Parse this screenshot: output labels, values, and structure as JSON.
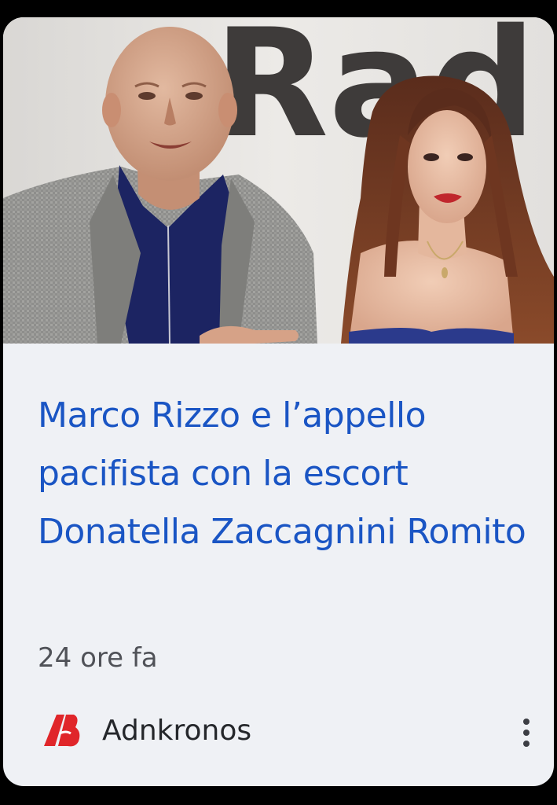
{
  "article": {
    "thumbnail": {
      "description_icon": "news-photo-thumbnail",
      "background_text": "Rad"
    },
    "headline": "Marco Rizzo e l’appello pacifista con la escort Donatella Zaccagnini Romito",
    "time": "24 ore fa",
    "source": {
      "name": "Adnkronos",
      "logo_icon": "adnkronos-logo-icon"
    },
    "more_icon": "more-vert-icon"
  },
  "colors": {
    "card_background": "#eff1f5",
    "headline": "#1a55c4",
    "time": "#505258",
    "source_name": "#25272b",
    "logo_red": "#e0262a"
  }
}
